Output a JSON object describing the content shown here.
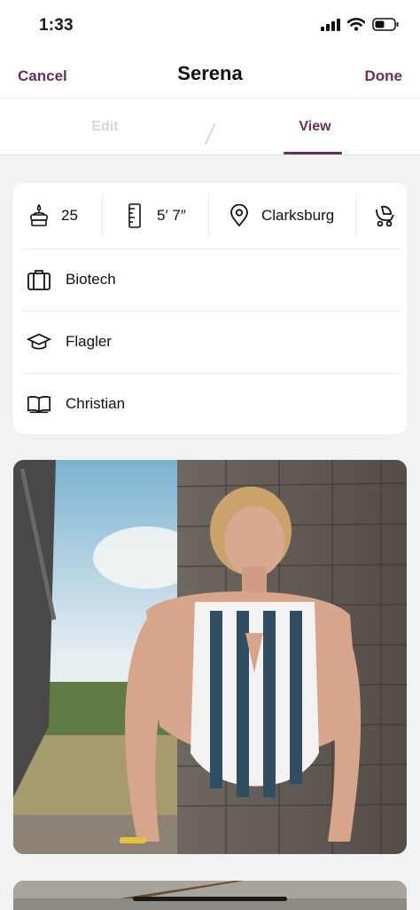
{
  "status_bar": {
    "time": "1:33"
  },
  "nav": {
    "cancel": "Cancel",
    "title": "Serena",
    "done": "Done"
  },
  "tabs": [
    {
      "label": "Edit"
    },
    {
      "label": "View"
    }
  ],
  "tabs_active": "View",
  "profile": {
    "stats": [
      {
        "icon": "birthday-cake-icon",
        "value": "25"
      },
      {
        "icon": "ruler-icon",
        "value": "5′ 7″"
      },
      {
        "icon": "location-pin-icon",
        "value": "Clarksburg"
      },
      {
        "icon": "baby-stroller-icon",
        "value": ""
      }
    ],
    "details": [
      {
        "icon": "briefcase-icon",
        "value": "Biotech"
      },
      {
        "icon": "graduation-cap-icon",
        "value": "Flagler"
      },
      {
        "icon": "book-icon",
        "value": "Christian"
      }
    ]
  },
  "accent_color": "#6b2d5c"
}
